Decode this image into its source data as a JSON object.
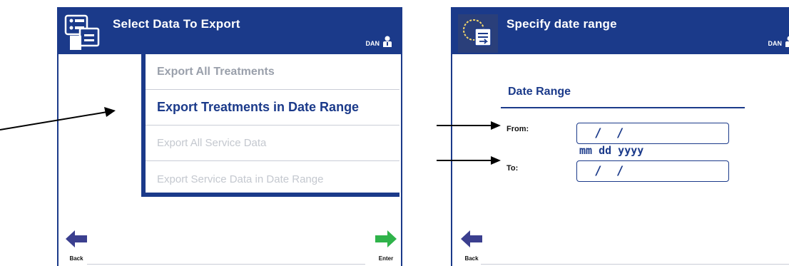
{
  "left_screen": {
    "title": "Select Data To Export",
    "user": "DAN",
    "menu": [
      "Export All Treatments",
      "Export Treatments in Date Range",
      "Export All Service Data",
      "Export Service Data in Date Range"
    ],
    "back_label": "Back",
    "enter_label": "Enter"
  },
  "right_screen": {
    "title": "Specify date range",
    "user": "DAN",
    "section_title": "Date Range",
    "from_label": "From:",
    "to_label": "To:",
    "from_value": " /  /",
    "to_value": " /  /",
    "date_format_hint": "mm dd yyyy",
    "back_label": "Back"
  },
  "colors": {
    "brand_blue": "#1b3a8a",
    "back_arrow": "#3b3f8f",
    "enter_arrow": "#2fb34a"
  },
  "icons": [
    "data-export-icon",
    "user-icon",
    "back-arrow-icon",
    "enter-arrow-icon",
    "date-range-icon",
    "callout-arrow-icon"
  ]
}
